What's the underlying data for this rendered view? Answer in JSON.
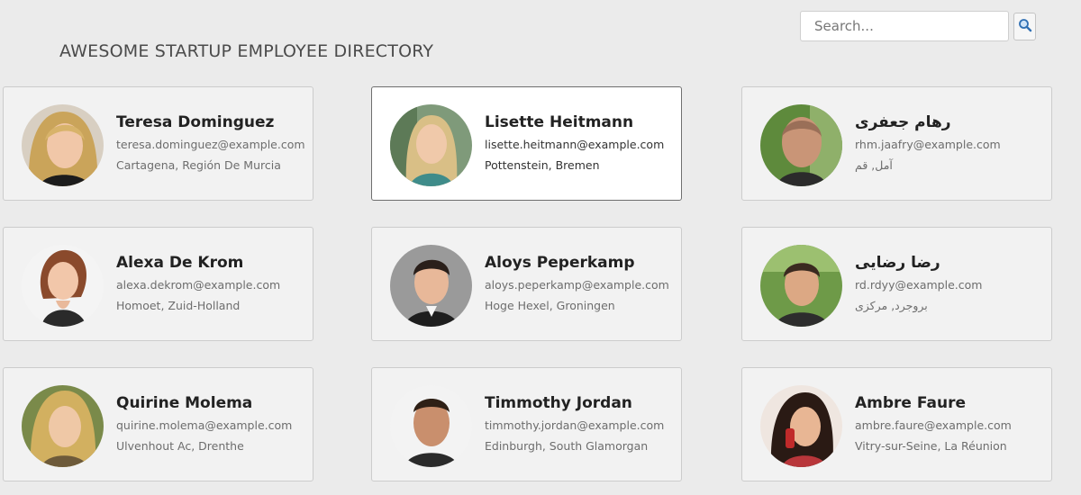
{
  "header": {
    "title": "AWESOME STARTUP EMPLOYEE DIRECTORY"
  },
  "search": {
    "placeholder": "Search...",
    "value": "",
    "button_icon": "magnifier-icon"
  },
  "employees": [
    {
      "name": "Teresa Dominguez",
      "email": "teresa.dominguez@example.com",
      "location": "Cartagena, Región De Murcia",
      "avatar": "photo-woman-blonde-icon"
    },
    {
      "name": "Lisette Heitmann",
      "email": "lisette.heitmann@example.com",
      "location": "Pottenstein, Bremen",
      "avatar": "photo-woman-blonde-icon",
      "selected": true
    },
    {
      "name": "رهام جعفری",
      "email": "rhm.jaafry@example.com",
      "location": "آمل, قم",
      "avatar": "photo-man-bald-icon"
    },
    {
      "name": "Alexa De Krom",
      "email": "alexa.dekrom@example.com",
      "location": "Homoet, Zuid-Holland",
      "avatar": "photo-woman-red-hair-icon"
    },
    {
      "name": "Aloys Peperkamp",
      "email": "aloys.peperkamp@example.com",
      "location": "Hoge Hexel, Groningen",
      "avatar": "photo-man-dark-hair-icon"
    },
    {
      "name": "رضا رضایی",
      "email": "rd.rdyy@example.com",
      "location": "بروجرد, مرکزی",
      "avatar": "photo-man-smiling-icon"
    },
    {
      "name": "Quirine Molema",
      "email": "quirine.molema@example.com",
      "location": "Ulvenhout Ac, Drenthe",
      "avatar": "photo-woman-blonde-icon"
    },
    {
      "name": "Timmothy Jordan",
      "email": "timmothy.jordan@example.com",
      "location": "Edinburgh, South Glamorgan",
      "avatar": "photo-man-short-hair-icon"
    },
    {
      "name": "Ambre Faure",
      "email": "ambre.faure@example.com",
      "location": "Vitry-sur-Seine, La Réunion",
      "avatar": "photo-woman-dark-hair-icon"
    }
  ],
  "colors": {
    "page_background": "#ebebeb",
    "card_background": "#f2f2f2",
    "card_selected_background": "#ffffff",
    "title_text": "#4b4b4b",
    "secondary_text": "#6d6d6d"
  }
}
